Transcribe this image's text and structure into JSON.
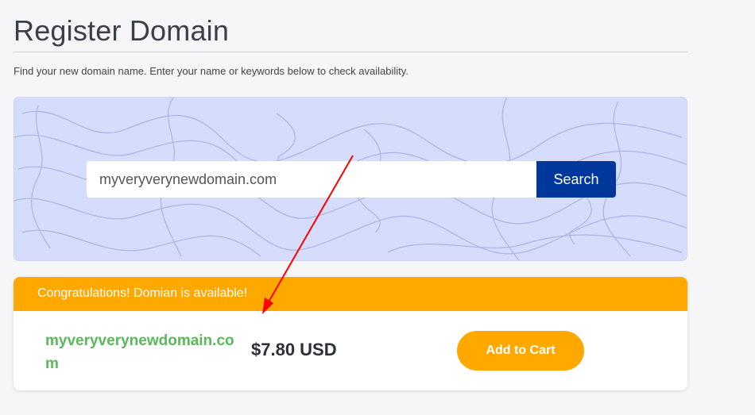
{
  "page": {
    "title": "Register Domain",
    "intro": "Find your new domain name. Enter your name or keywords below to check availability."
  },
  "search": {
    "value": "myveryverynewdomain.com",
    "button_label": "Search"
  },
  "result": {
    "status": "Congratulations! Domian is available!",
    "domain": "myveryverynewdomain.com",
    "price": "$7.80 USD",
    "add_to_cart_label": "Add to Cart"
  },
  "colors": {
    "accent_orange": "#ffa800",
    "search_button": "#00379a",
    "available_green": "#5cb85c",
    "annotation_arrow": "#ff0000"
  },
  "icons": [
    "annotation-arrow-icon"
  ]
}
